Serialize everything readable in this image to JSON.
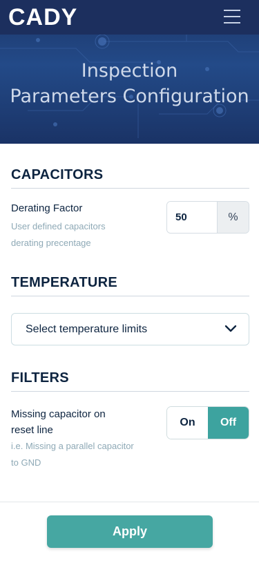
{
  "header": {
    "logo": "CADY",
    "title_line1": "Inspection",
    "title_line2": "Parameters Configuration"
  },
  "capacitors": {
    "section_title": "CAPACITORS",
    "derating_label": "Derating Factor",
    "derating_hint_line1": "User defined capacitors",
    "derating_hint_line2": "derating precentage",
    "derating_value": "50",
    "derating_unit": "%"
  },
  "temperature": {
    "section_title": "TEMPERATURE",
    "select_value": "Select temperature limits"
  },
  "filters": {
    "section_title": "FILTERS",
    "missing_label_line1": "Missing capacitor on",
    "missing_label_line2": "reset line",
    "missing_hint_line1": "i.e. Missing a parallel capacitor",
    "missing_hint_line2": "to GND",
    "toggle_on": "On",
    "toggle_off": "Off",
    "toggle_selected": "Off"
  },
  "footer": {
    "apply_label": "Apply"
  },
  "colors": {
    "accent": "#46a7a2",
    "header_bg": "#1c2f5e",
    "heading_text": "#0d2440",
    "hint_text": "#8ea9b6"
  },
  "icons": {
    "menu": "hamburger-menu-icon",
    "select": "chevron-down-icon"
  }
}
